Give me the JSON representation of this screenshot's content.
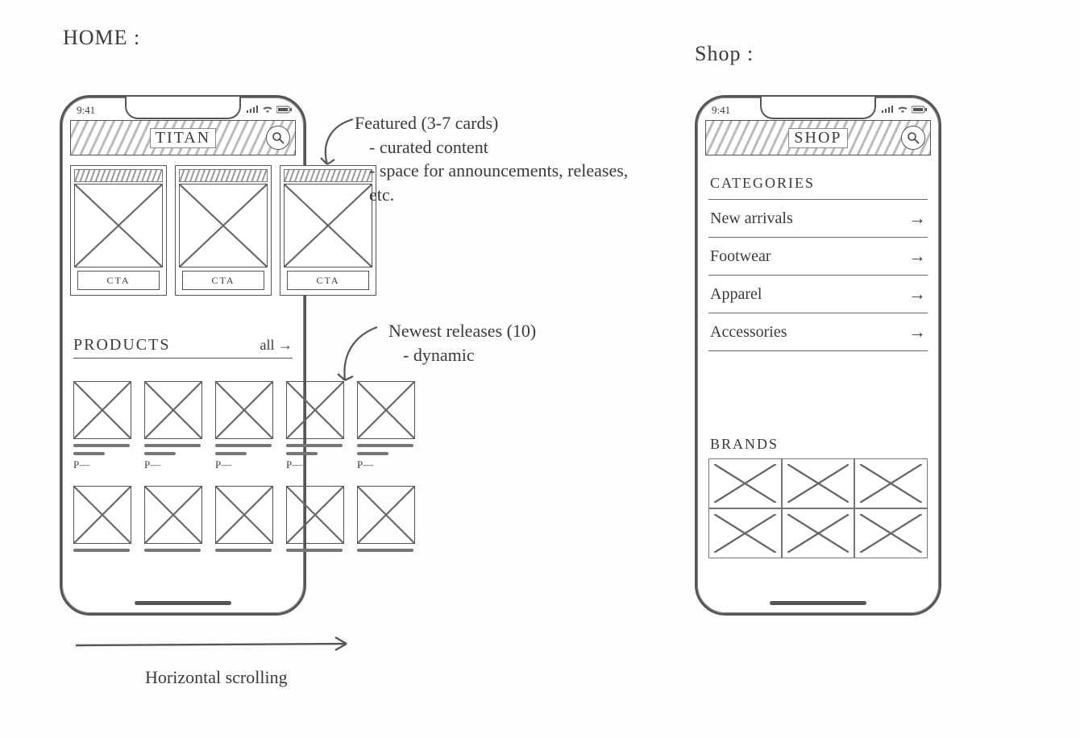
{
  "labels": {
    "home": "HOME :",
    "shop": "Shop :",
    "horizontal_scrolling": "Horizontal scrolling"
  },
  "annotations": {
    "featured_title": "Featured (3-7 cards)",
    "featured_b1": "- curated content",
    "featured_b2": "- space for announcements, releases, etc.",
    "newest_title": "Newest releases (10)",
    "newest_b1": "- dynamic"
  },
  "home": {
    "status_time": "9:41",
    "header_title": "TITAN",
    "search_icon": "search",
    "featured_cta": "CTA",
    "products_heading": "PRODUCTS",
    "products_all": "all →",
    "product_price_placeholder": "P—",
    "featured_count": 3,
    "products_count": 10
  },
  "shop": {
    "status_time": "9:41",
    "header_title": "SHOP",
    "search_icon": "search",
    "categories_heading": "CATEGORIES",
    "categories": [
      "New arrivals",
      "Footwear",
      "Apparel",
      "Accessories"
    ],
    "brands_heading": "BRANDS",
    "brand_cells": 6,
    "arrow": "→"
  }
}
